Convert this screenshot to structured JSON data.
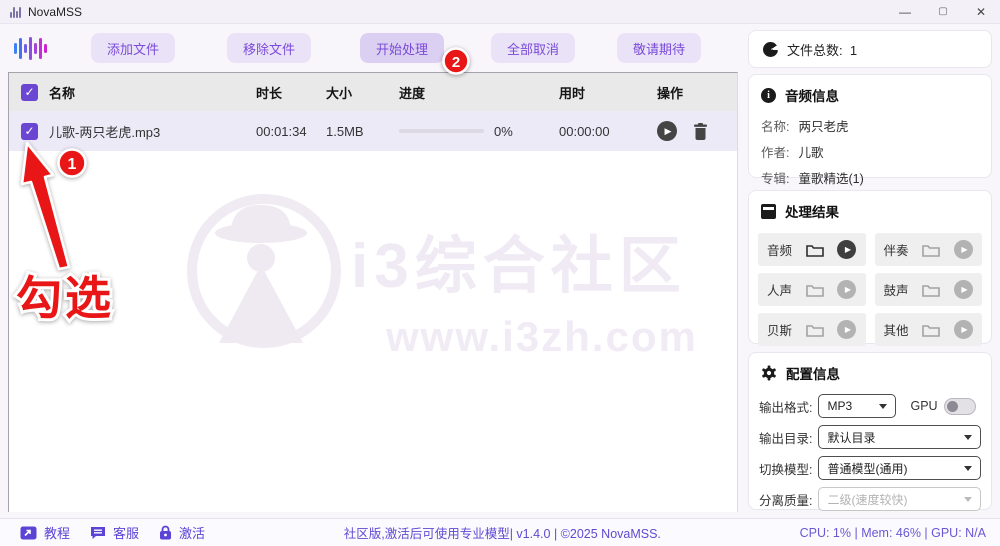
{
  "window": {
    "title": "NovaMSS",
    "controls": {
      "minimize": "—",
      "maximize": "▢",
      "close": "✕"
    }
  },
  "toolbar": {
    "buttons": [
      {
        "label": "添加文件"
      },
      {
        "label": "移除文件"
      },
      {
        "label": "开始处理"
      },
      {
        "label": "全部取消"
      },
      {
        "label": "敬请期待"
      }
    ]
  },
  "summary": {
    "label": "文件总数:",
    "value": "1"
  },
  "table": {
    "columns": [
      "名称",
      "时长",
      "大小",
      "进度",
      "用时",
      "操作"
    ],
    "rows": [
      {
        "name": "儿歌-两只老虎.mp3",
        "duration": "00:01:34",
        "size": "1.5MB",
        "progress_percent": 0,
        "progress_label": "0%",
        "elapsed": "00:00:00"
      }
    ]
  },
  "audio_info": {
    "title": "音频信息",
    "fields": [
      {
        "label": "名称:",
        "value": "两只老虎"
      },
      {
        "label": "作者:",
        "value": "儿歌"
      },
      {
        "label": "专辑:",
        "value": "童歌精选(1)"
      }
    ]
  },
  "results": {
    "title": "处理结果",
    "items": [
      {
        "label": "音频",
        "enabled": true
      },
      {
        "label": "伴奏",
        "enabled": false
      },
      {
        "label": "人声",
        "enabled": false
      },
      {
        "label": "鼓声",
        "enabled": false
      },
      {
        "label": "贝斯",
        "enabled": false
      },
      {
        "label": "其他",
        "enabled": false
      }
    ]
  },
  "config": {
    "title": "配置信息",
    "output_format": {
      "label": "输出格式:",
      "value": "MP3"
    },
    "gpu": {
      "label": "GPU",
      "enabled": false
    },
    "output_dir": {
      "label": "输出目录:",
      "value": "默认目录"
    },
    "model": {
      "label": "切换模型:",
      "value": "普通模型(通用)"
    },
    "quality": {
      "label": "分离质量:",
      "value": "二级(速度较快)",
      "disabled": true
    }
  },
  "footer": {
    "links": [
      {
        "label": "教程"
      },
      {
        "label": "客服"
      },
      {
        "label": "激活"
      }
    ],
    "center": "社区版,激活后可使用专业模型| v1.4.0 | ©2025 NovaMSS.",
    "stats": "CPU: 1% | Mem: 46% | GPU: N/A"
  },
  "watermark": {
    "title": "i3综合社区",
    "url": "www.i3zh.com"
  },
  "annotations": {
    "step1": "1",
    "step2": "2",
    "callout": "勾选"
  },
  "colors": {
    "accent": "#6b46d2",
    "annotation_red": "#e81616"
  }
}
